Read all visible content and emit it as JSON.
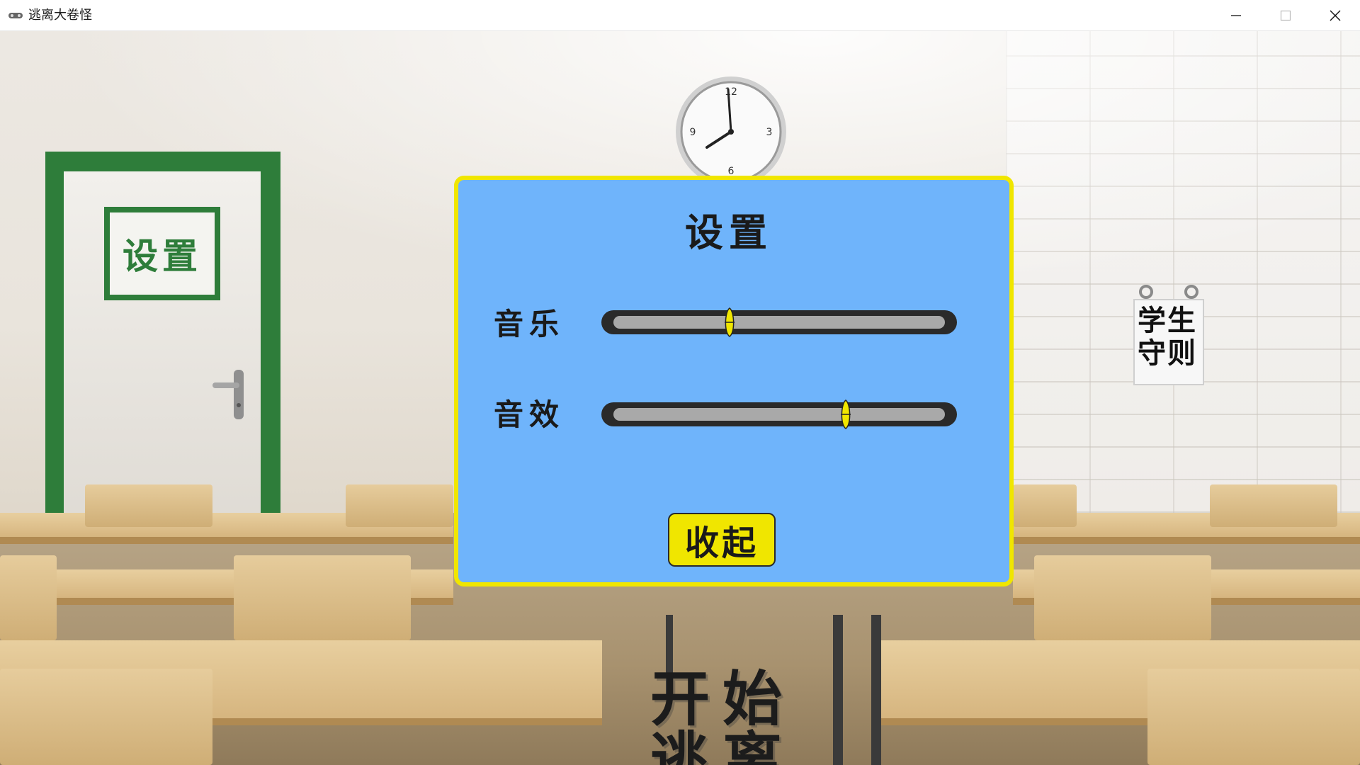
{
  "window": {
    "title": "逃离大卷怪",
    "app_icon": "gamepad-icon",
    "controls": [
      "minimize-icon",
      "maximize-icon",
      "close-icon"
    ]
  },
  "scene": {
    "door_sign": "设置",
    "rules_sign": [
      "学生",
      "守则"
    ],
    "start_button": [
      "开始",
      "逃离"
    ]
  },
  "settings_panel": {
    "title": "设置",
    "music_label": "音乐",
    "sfx_label": "音效",
    "music_level": 0.35,
    "sfx_level": 0.7,
    "collapse_label": "收起"
  },
  "colors": {
    "panel_bg": "#6fb4fb",
    "panel_border": "#f0e600",
    "button_bg": "#f0e600",
    "door_green": "#2e7d3a"
  }
}
